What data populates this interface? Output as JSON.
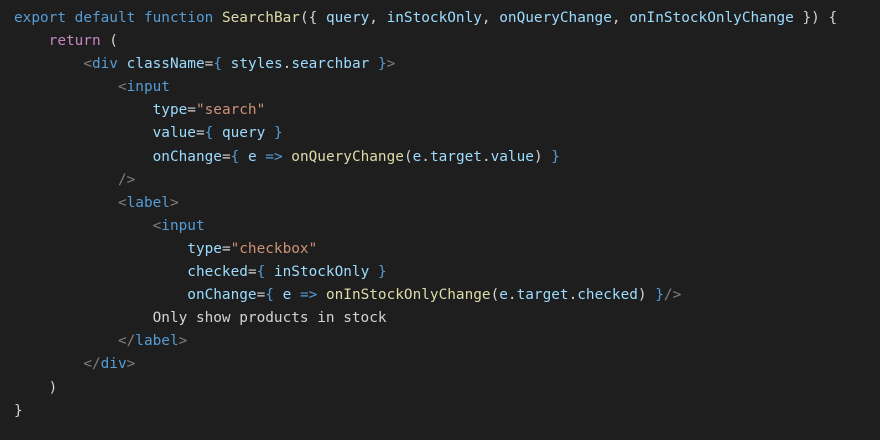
{
  "code": {
    "language": "jsx",
    "lines": [
      [
        {
          "t": "export",
          "c": "kw"
        },
        {
          "t": " "
        },
        {
          "t": "default",
          "c": "kw"
        },
        {
          "t": " "
        },
        {
          "t": "function",
          "c": "kw"
        },
        {
          "t": " "
        },
        {
          "t": "SearchBar",
          "c": "fn"
        },
        {
          "t": "({ "
        },
        {
          "t": "query",
          "c": "var"
        },
        {
          "t": ", "
        },
        {
          "t": "inStockOnly",
          "c": "var"
        },
        {
          "t": ", "
        },
        {
          "t": "onQueryChange",
          "c": "var"
        },
        {
          "t": ", "
        },
        {
          "t": "onInStockOnlyChange",
          "c": "var"
        },
        {
          "t": " }) {"
        }
      ],
      [
        {
          "t": "    "
        },
        {
          "t": "return",
          "c": "ctrl"
        },
        {
          "t": " ("
        }
      ],
      [
        {
          "t": "        "
        },
        {
          "t": "<",
          "c": "tag"
        },
        {
          "t": "div",
          "c": "tagname"
        },
        {
          "t": " "
        },
        {
          "t": "className",
          "c": "attr"
        },
        {
          "t": "="
        },
        {
          "t": "{",
          "c": "brace"
        },
        {
          "t": " "
        },
        {
          "t": "styles",
          "c": "var"
        },
        {
          "t": "."
        },
        {
          "t": "searchbar",
          "c": "var"
        },
        {
          "t": " "
        },
        {
          "t": "}",
          "c": "brace"
        },
        {
          "t": ">",
          "c": "tag"
        }
      ],
      [
        {
          "t": "            "
        },
        {
          "t": "<",
          "c": "tag"
        },
        {
          "t": "input",
          "c": "tagname"
        }
      ],
      [
        {
          "t": "                "
        },
        {
          "t": "type",
          "c": "attr"
        },
        {
          "t": "="
        },
        {
          "t": "\"search\"",
          "c": "str"
        }
      ],
      [
        {
          "t": "                "
        },
        {
          "t": "value",
          "c": "attr"
        },
        {
          "t": "="
        },
        {
          "t": "{",
          "c": "brace"
        },
        {
          "t": " "
        },
        {
          "t": "query",
          "c": "var"
        },
        {
          "t": " "
        },
        {
          "t": "}",
          "c": "brace"
        }
      ],
      [
        {
          "t": "                "
        },
        {
          "t": "onChange",
          "c": "attr"
        },
        {
          "t": "="
        },
        {
          "t": "{",
          "c": "brace"
        },
        {
          "t": " "
        },
        {
          "t": "e",
          "c": "var"
        },
        {
          "t": " "
        },
        {
          "t": "=>",
          "c": "kw"
        },
        {
          "t": " "
        },
        {
          "t": "onQueryChange",
          "c": "fn"
        },
        {
          "t": "("
        },
        {
          "t": "e",
          "c": "var"
        },
        {
          "t": "."
        },
        {
          "t": "target",
          "c": "var"
        },
        {
          "t": "."
        },
        {
          "t": "value",
          "c": "var"
        },
        {
          "t": ") "
        },
        {
          "t": "}",
          "c": "brace"
        }
      ],
      [
        {
          "t": "            "
        },
        {
          "t": "/>",
          "c": "tag"
        }
      ],
      [
        {
          "t": "            "
        },
        {
          "t": "<",
          "c": "tag"
        },
        {
          "t": "label",
          "c": "tagname"
        },
        {
          "t": ">",
          "c": "tag"
        }
      ],
      [
        {
          "t": "                "
        },
        {
          "t": "<",
          "c": "tag"
        },
        {
          "t": "input",
          "c": "tagname"
        }
      ],
      [
        {
          "t": "                    "
        },
        {
          "t": "type",
          "c": "attr"
        },
        {
          "t": "="
        },
        {
          "t": "\"checkbox\"",
          "c": "str"
        }
      ],
      [
        {
          "t": "                    "
        },
        {
          "t": "checked",
          "c": "attr"
        },
        {
          "t": "="
        },
        {
          "t": "{",
          "c": "brace"
        },
        {
          "t": " "
        },
        {
          "t": "inStockOnly",
          "c": "var"
        },
        {
          "t": " "
        },
        {
          "t": "}",
          "c": "brace"
        }
      ],
      [
        {
          "t": "                    "
        },
        {
          "t": "onChange",
          "c": "attr"
        },
        {
          "t": "="
        },
        {
          "t": "{",
          "c": "brace"
        },
        {
          "t": " "
        },
        {
          "t": "e",
          "c": "var"
        },
        {
          "t": " "
        },
        {
          "t": "=>",
          "c": "kw"
        },
        {
          "t": " "
        },
        {
          "t": "onInStockOnlyChange",
          "c": "fn"
        },
        {
          "t": "("
        },
        {
          "t": "e",
          "c": "var"
        },
        {
          "t": "."
        },
        {
          "t": "target",
          "c": "var"
        },
        {
          "t": "."
        },
        {
          "t": "checked",
          "c": "var"
        },
        {
          "t": ") "
        },
        {
          "t": "}",
          "c": "brace"
        },
        {
          "t": "/>",
          "c": "tag"
        }
      ],
      [
        {
          "t": "                "
        },
        {
          "t": "Only show products in stock",
          "c": "text"
        }
      ],
      [
        {
          "t": "            "
        },
        {
          "t": "</",
          "c": "tag"
        },
        {
          "t": "label",
          "c": "tagname"
        },
        {
          "t": ">",
          "c": "tag"
        }
      ],
      [
        {
          "t": "        "
        },
        {
          "t": "</",
          "c": "tag"
        },
        {
          "t": "div",
          "c": "tagname"
        },
        {
          "t": ">",
          "c": "tag"
        }
      ],
      [
        {
          "t": "    "
        },
        {
          "t": ")"
        }
      ],
      [
        {
          "t": "}"
        }
      ]
    ]
  },
  "theme": {
    "background": "#1e1e1e",
    "default_text": "#d4d4d4",
    "keyword": "#569cd6",
    "control_keyword": "#c586c0",
    "function": "#dcdcaa",
    "variable": "#9cdcfe",
    "string": "#ce9178",
    "tag_punctuation": "#808080"
  }
}
